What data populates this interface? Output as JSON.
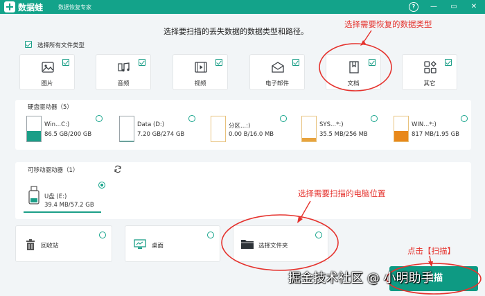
{
  "titlebar": {
    "app_name": "数据蛙",
    "subtitle": "数据恢复专家",
    "help": "?",
    "minimize": "—",
    "maximize": "▭",
    "close": "✕"
  },
  "heading": "选择要扫描的丢失数据的数据类型和路径。",
  "select_all": {
    "label": "选择所有文件类型",
    "checked": true
  },
  "file_types": [
    {
      "label": "图片",
      "icon": "image-icon",
      "checked": true
    },
    {
      "label": "音频",
      "icon": "music-icon",
      "checked": true
    },
    {
      "label": "视频",
      "icon": "video-icon",
      "checked": true
    },
    {
      "label": "电子邮件",
      "icon": "email-icon",
      "checked": true
    },
    {
      "label": "文档",
      "icon": "document-icon",
      "checked": true
    },
    {
      "label": "其它",
      "icon": "other-icon",
      "checked": true
    }
  ],
  "hard_drives": {
    "title": "硬盘驱动器（5）",
    "items": [
      {
        "name": "Win...C:)",
        "size": "86.5 GB/200 GB",
        "fill": 0.43,
        "color": "#1a9e87"
      },
      {
        "name": "Data (D:)",
        "size": "7.20 GB/274 GB",
        "fill": 0.03,
        "color": "#1a9e87"
      },
      {
        "name": "分区...:)",
        "size": "0.00  B/16.0 MB",
        "fill": 0.0,
        "color": "#e8a33d"
      },
      {
        "name": "SYS...*:)",
        "size": "35.5 MB/256 MB",
        "fill": 0.14,
        "color": "#e8a33d"
      },
      {
        "name": "WIN...*:)",
        "size": "817 MB/1.95 GB",
        "fill": 0.42,
        "color": "#e8881a"
      }
    ]
  },
  "removable": {
    "title": "可移动驱动器（1）",
    "refresh_icon": "refresh-icon",
    "items": [
      {
        "name": "U盘 (E:)",
        "size": "39.4 MB/57.2 GB",
        "selected": true
      }
    ]
  },
  "locations": [
    {
      "label": "回收站",
      "icon": "trash-icon"
    },
    {
      "label": "桌面",
      "icon": "desktop-icon"
    },
    {
      "label": "选择文件夹",
      "icon": "folder-icon"
    }
  ],
  "scan_button": "扫描",
  "annotations": {
    "type_hint": "选择需要恢复的数据类型",
    "location_hint": "选择需要扫描的电脑位置",
    "scan_hint": "点击【扫描】"
  },
  "watermark": "掘金技术社区 @ 小明助手",
  "colors": {
    "accent": "#13a38a",
    "annotation": "#e5322d"
  }
}
